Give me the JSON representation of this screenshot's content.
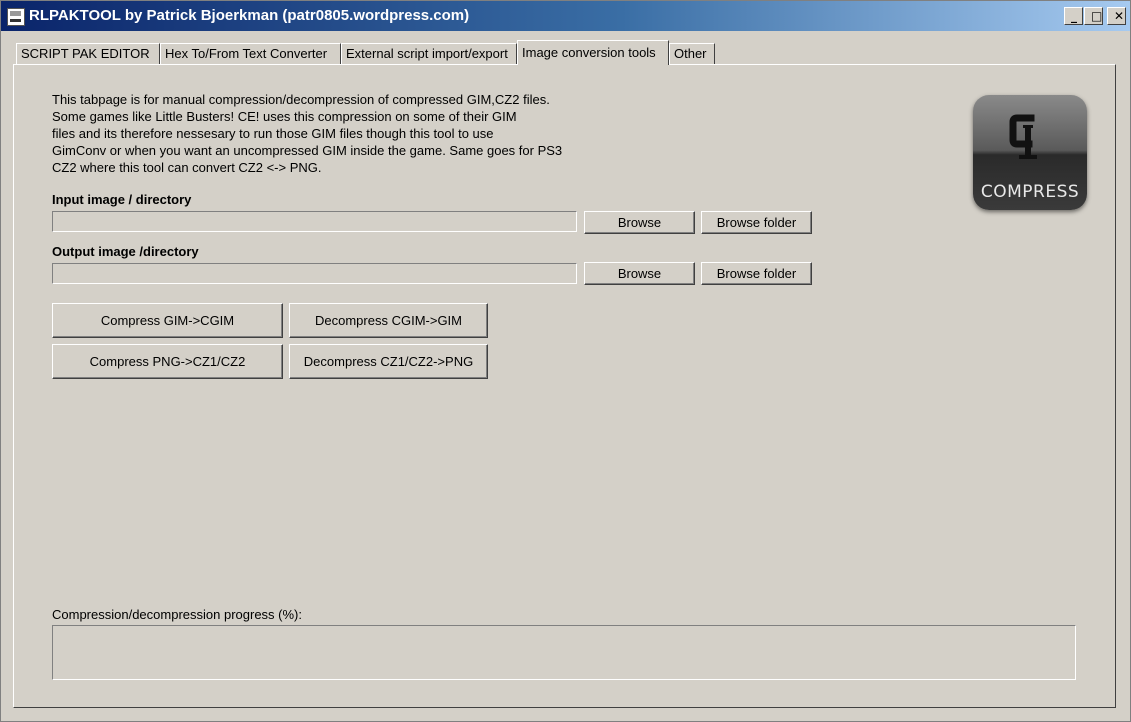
{
  "window": {
    "title": "RLPAKTOOL by Patrick Bjoerkman (patr0805.wordpress.com)",
    "controls": {
      "minimize": "_",
      "maximize": "□",
      "close": "✕"
    }
  },
  "tabs": [
    {
      "label": "SCRIPT PAK EDITOR",
      "active": false
    },
    {
      "label": "Hex To/From Text Converter",
      "active": false
    },
    {
      "label": "External script import/export",
      "active": false
    },
    {
      "label": "Image conversion tools",
      "active": true
    },
    {
      "label": "Other",
      "active": false
    }
  ],
  "description": [
    "This tabpage is for manual compression/decompression of compressed GIM,CZ2 files.",
    "Some games like Little Busters! CE! uses this compression on some of their GIM",
    "files and its therefore nessesary to run those GIM files though this tool to use",
    "GimConv or when you want an uncompressed GIM inside the game. Same goes for PS3",
    "CZ2 where this tool can convert CZ2 <-> PNG."
  ],
  "input": {
    "label": "Input image / directory",
    "value": "",
    "browse": "Browse",
    "browse_folder": "Browse folder"
  },
  "output": {
    "label": "Output image /directory",
    "value": "",
    "browse": "Browse",
    "browse_folder": "Browse folder"
  },
  "actions": {
    "compress_gim": "Compress GIM->CGIM",
    "decompress_cgim": "Decompress CGIM->GIM",
    "compress_png": "Compress PNG->CZ1/CZ2",
    "decompress_cz": "Decompress CZ1/CZ2->PNG"
  },
  "logo": {
    "text": "COMPRESS",
    "icon": "clamp-icon"
  },
  "progress": {
    "label": "Compression/decompression progress (%):",
    "value": 0
  }
}
